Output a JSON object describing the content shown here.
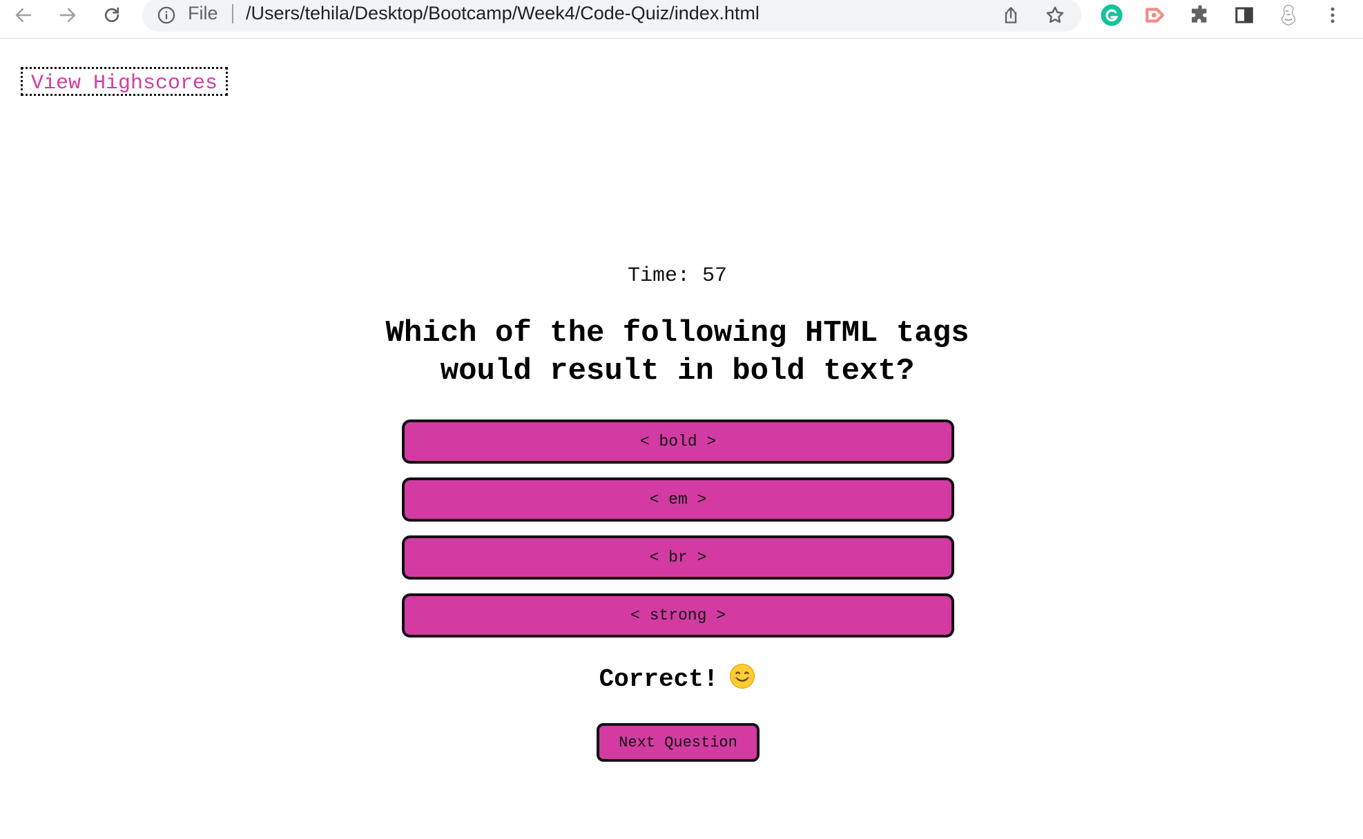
{
  "browser": {
    "omnibox_scheme": "File",
    "url": "/Users/tehila/Desktop/Bootcamp/Week4/Code-Quiz/index.html",
    "icons": {
      "back": "back-arrow-icon",
      "forward": "forward-arrow-icon",
      "reload": "reload-icon",
      "info": "info-icon",
      "share": "share-icon",
      "bookmark": "star-icon",
      "grammarly": "grammarly-extension-icon",
      "recorder": "screen-recorder-extension-icon",
      "extensions": "puzzle-icon",
      "side_panel": "side-panel-icon",
      "profile": "profile-avatar-icon",
      "menu": "kebab-menu-icon"
    }
  },
  "header": {
    "highscores_link": "View Highscores"
  },
  "quiz": {
    "timer_label": "Time:",
    "timer_value": "57",
    "question": "Which of the following HTML tags would result in bold text?",
    "answers": [
      "< bold >",
      "< em >",
      "< br >",
      "< strong >"
    ],
    "feedback_text": "Correct!",
    "feedback_emoji": "smiling-face-icon",
    "next_button": "Next Question"
  },
  "colors": {
    "accent": "#d33ba3",
    "border": "#111111",
    "text": "#000000"
  }
}
